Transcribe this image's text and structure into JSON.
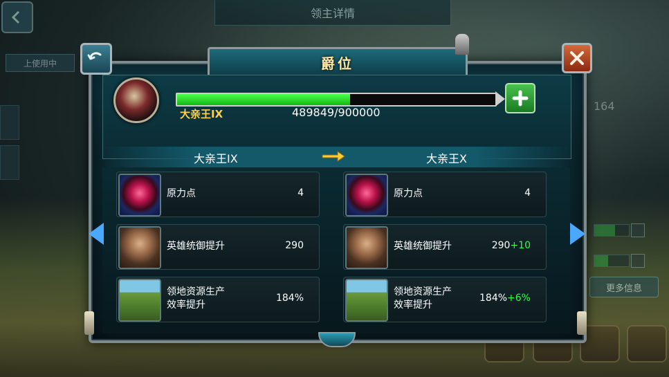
{
  "background": {
    "title": "领主详情",
    "in_use_label": "上使用中",
    "stat_number": "164",
    "more_info_label": "更多信息",
    "bar1_fraction": 0.6,
    "bar2_fraction": 0.4
  },
  "dialog": {
    "title": "爵位",
    "progress": {
      "current_rank": "大亲王IX",
      "current": 489849,
      "max": 900000,
      "text": "489849/900000",
      "fraction": 0.544
    },
    "comparison": {
      "from_rank": "大亲王IX",
      "to_rank": "大亲王X",
      "left": [
        {
          "name": "原力点",
          "value": "4",
          "bonus": ""
        },
        {
          "name": "英雄统御提升",
          "value": "290",
          "bonus": ""
        },
        {
          "name": "领地资源生产\n效率提升",
          "value": "184%",
          "bonus": ""
        }
      ],
      "right": [
        {
          "name": "原力点",
          "value": "4",
          "bonus": ""
        },
        {
          "name": "英雄统御提升",
          "value": "290",
          "bonus": "+10"
        },
        {
          "name": "领地资源生产\n效率提升",
          "value": "184%",
          "bonus": "+6%"
        }
      ]
    }
  },
  "colors": {
    "gold": "#ffd24a",
    "bonus_green": "#2dff4a",
    "progress_green": "#22cc22",
    "nav_arrow_blue": "#4aa8ff"
  },
  "icons": [
    "back-arrow-icon",
    "close-x-icon",
    "plus-icon",
    "rank-emblem-icon",
    "gem-icon",
    "hero-portrait-icon",
    "land-upgrade-icon",
    "right-arrow-icon"
  ]
}
